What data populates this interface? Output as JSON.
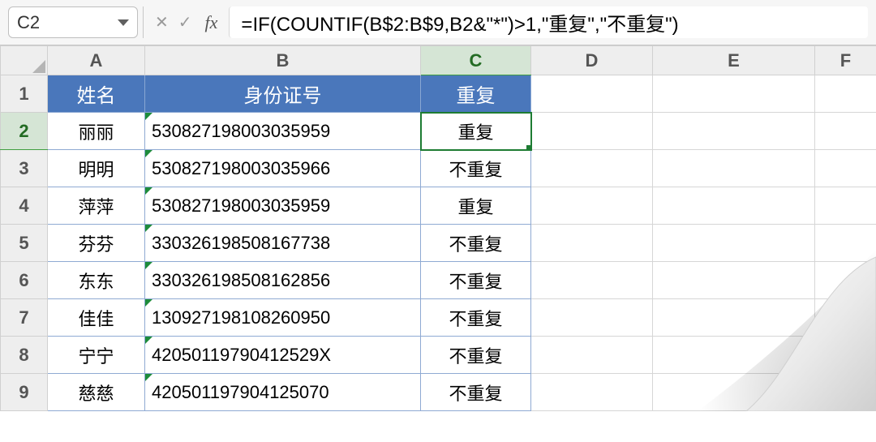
{
  "formulaBar": {
    "nameBox": "C2",
    "fxLabel": "fx",
    "formula": "=IF(COUNTIF(B$2:B$9,B2&\"*\")>1,\"重复\",\"不重复\")"
  },
  "columns": [
    "A",
    "B",
    "C",
    "D",
    "E",
    "F"
  ],
  "headerRow": {
    "A": "姓名",
    "B": "身份证号",
    "C": "重复"
  },
  "rows": [
    {
      "n": "1"
    },
    {
      "n": "2",
      "A": "丽丽",
      "B": "530827198003035959",
      "C": "重复"
    },
    {
      "n": "3",
      "A": "明明",
      "B": "530827198003035966",
      "C": "不重复"
    },
    {
      "n": "4",
      "A": "萍萍",
      "B": "530827198003035959",
      "C": "重复"
    },
    {
      "n": "5",
      "A": "芬芬",
      "B": "330326198508167738",
      "C": "不重复"
    },
    {
      "n": "6",
      "A": "东东",
      "B": "330326198508162856",
      "C": "不重复"
    },
    {
      "n": "7",
      "A": "佳佳",
      "B": "130927198108260950",
      "C": "不重复"
    },
    {
      "n": "8",
      "A": "宁宁",
      "B": "42050119790412529X",
      "C": "不重复"
    },
    {
      "n": "9",
      "A": "慈慈",
      "B": "420501197904125070",
      "C": "不重复"
    }
  ],
  "activeCell": "C2"
}
